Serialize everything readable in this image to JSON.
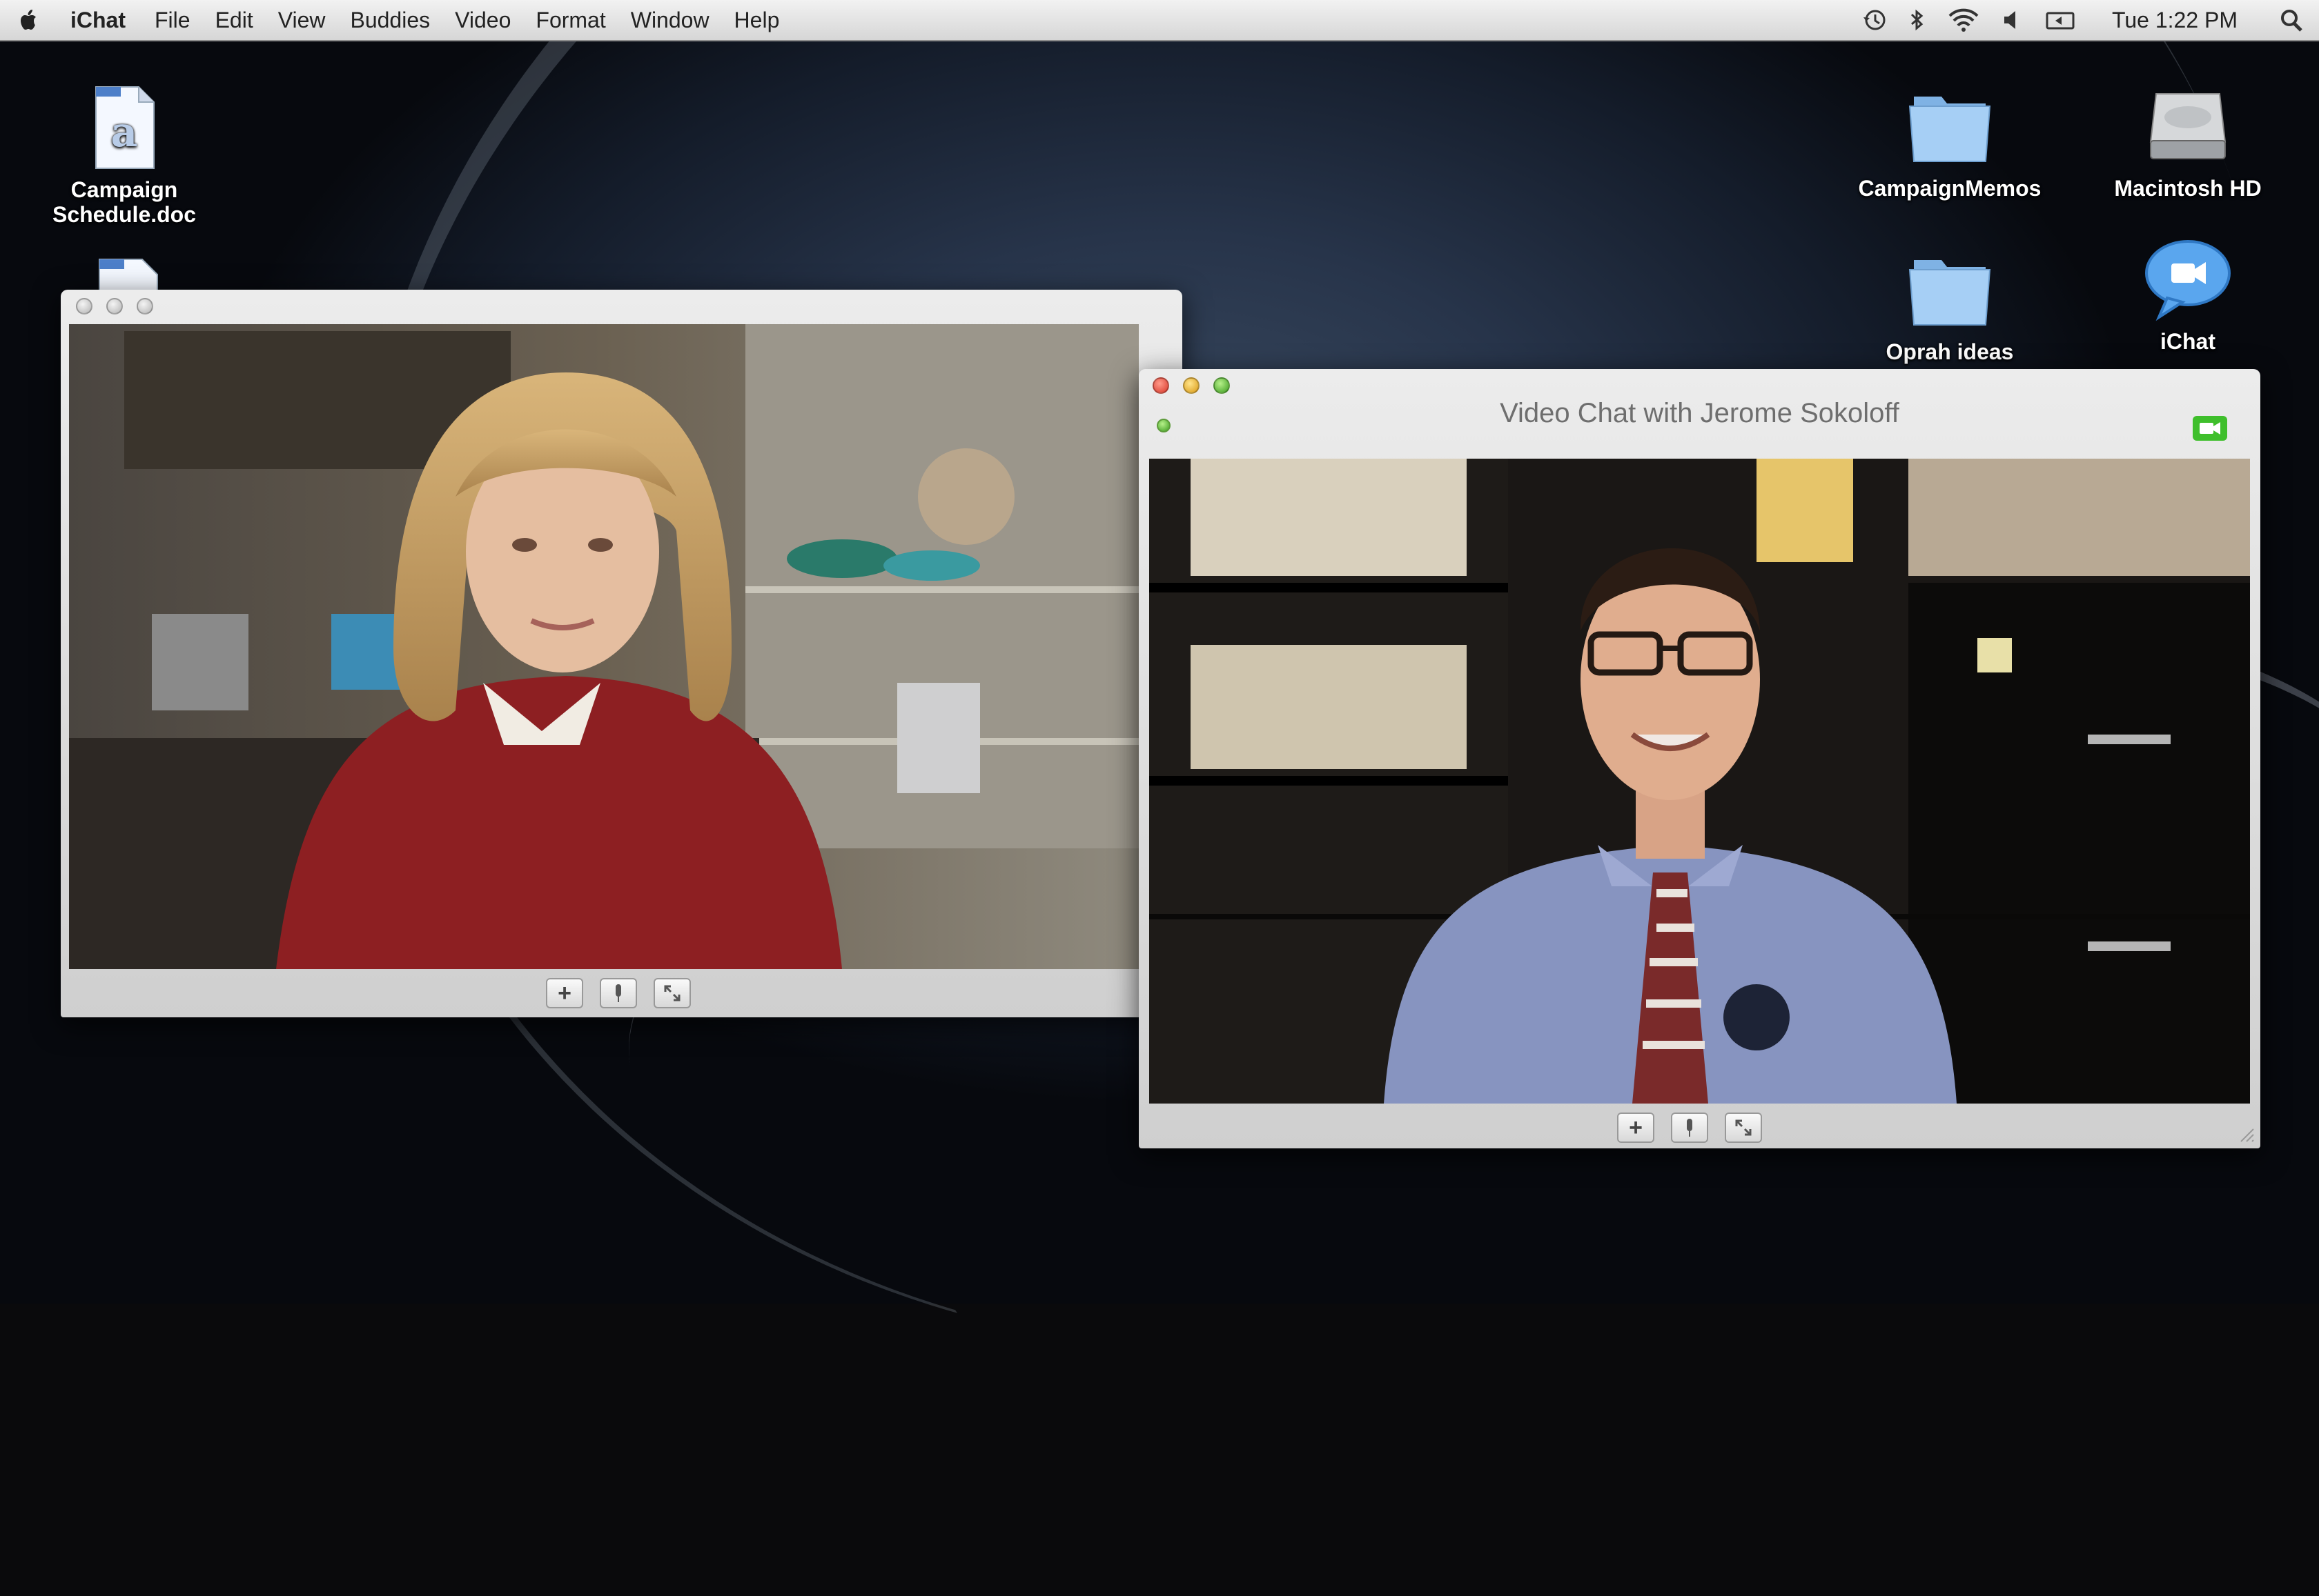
{
  "menubar": {
    "app": "iChat",
    "items": [
      "File",
      "Edit",
      "View",
      "Buddies",
      "Video",
      "Format",
      "Window",
      "Help"
    ],
    "clock": "Tue 1:22 PM"
  },
  "desktop_icons": {
    "campaign_schedule": [
      "Campaign",
      "Schedule.doc"
    ],
    "campaign_memos": "CampaignMemos",
    "macintosh_hd": "Macintosh HD",
    "oprah_ideas": "Oprah ideas",
    "ichat": "iChat"
  },
  "chat_window": {
    "title": "Video Chat with Jerome Sokoloff"
  },
  "colors": {
    "accent_green": "#3fbf2c",
    "menubar": "#e4e4e4"
  }
}
